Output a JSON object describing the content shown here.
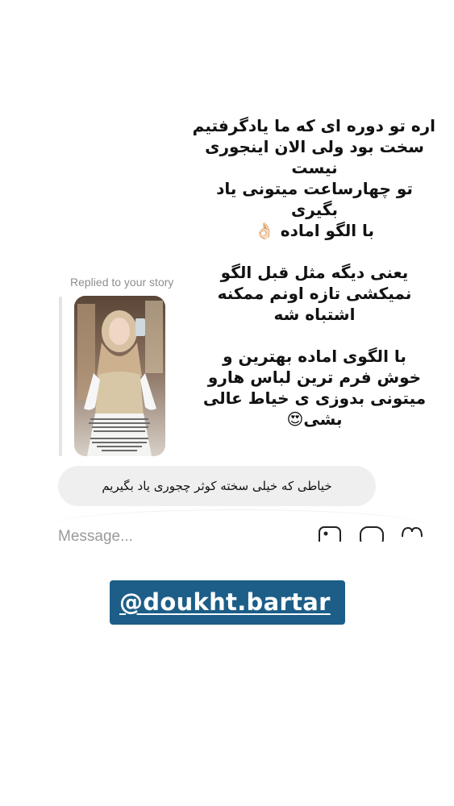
{
  "story": {
    "lines": [
      "اره تو دوره ای که ما یادگرفتیم",
      "سخت بود ولی الان اینجوری",
      "نیست",
      "تو چهارساعت میتونی یاد",
      "بگیری",
      "با الگو اماده 👌🏻",
      "",
      "یعنی دیگه مثل قبل الگو",
      "نمیکشی تازه اونم ممکنه",
      "اشتباه شه",
      "",
      "با الگوی اماده بهترین و",
      "خوش فرم ترین لباس هارو",
      "میتونی بدوزی ی خیاط عالی",
      "بشی😍"
    ]
  },
  "reply": {
    "label": "Replied to your story"
  },
  "message": {
    "text": "خیاطی که خیلی سخته کوثر چجوری یاد بگیریم"
  },
  "composer": {
    "placeholder": "Message...",
    "icons": [
      "photo-icon",
      "sticker-icon",
      "heart-icon"
    ]
  },
  "mention": {
    "handle": "@doukht.bartar",
    "color": "#1c5e88"
  }
}
